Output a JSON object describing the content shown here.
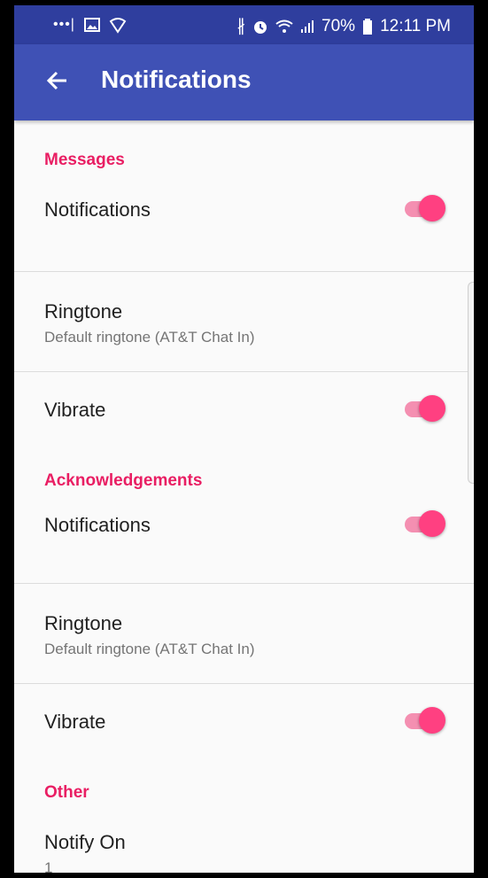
{
  "statusbar": {
    "left_icons": [
      "more-dots-icon",
      "image-icon",
      "shield-icon"
    ],
    "right_icons": [
      "bluetooth-icon",
      "alarm-icon",
      "wifi-icon",
      "signal-icon",
      "battery-icon"
    ],
    "battery": "70%",
    "time": "12:11 PM"
  },
  "appbar": {
    "title": "Notifications",
    "back_icon": "arrow-left-icon",
    "color": "#3f51b5"
  },
  "accent_color": "#e91e63",
  "sections": {
    "messages": {
      "header": "Messages",
      "notifications": {
        "title": "Notifications",
        "enabled": true
      },
      "ringtone": {
        "title": "Ringtone",
        "summary": "Default ringtone (AT&T Chat In)"
      },
      "vibrate": {
        "title": "Vibrate",
        "enabled": true
      }
    },
    "acknowledgements": {
      "header": "Acknowledgements",
      "notifications": {
        "title": "Notifications",
        "enabled": true
      },
      "ringtone": {
        "title": "Ringtone",
        "summary": "Default ringtone (AT&T Chat In)"
      },
      "vibrate": {
        "title": "Vibrate",
        "enabled": true
      }
    },
    "other": {
      "header": "Other",
      "notify_on": {
        "title": "Notify On",
        "summary": "1"
      }
    }
  }
}
